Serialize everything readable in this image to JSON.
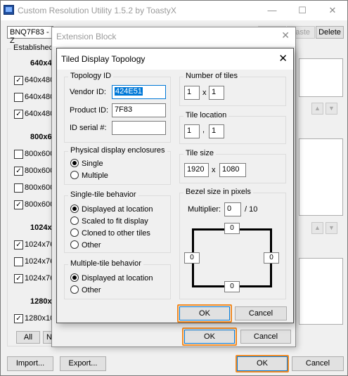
{
  "main": {
    "title": "Custom Resolution Utility 1.5.2 by ToastyX",
    "monitor": "BNQ7F83 - Z",
    "paste": "aste",
    "delete": "Delete",
    "established": "Established",
    "groups": [
      {
        "header": "640x48",
        "items": [
          {
            "label": "640x480",
            "checked": true
          },
          {
            "label": "640x480",
            "checked": false
          },
          {
            "label": "640x480",
            "checked": true
          }
        ]
      },
      {
        "header": "800x60",
        "items": [
          {
            "label": "800x600",
            "checked": false
          },
          {
            "label": "800x600",
            "checked": true
          },
          {
            "label": "800x600",
            "checked": false
          },
          {
            "label": "800x600",
            "checked": true
          }
        ]
      },
      {
        "header": "1024x7",
        "items": [
          {
            "label": "1024x76",
            "checked": true
          },
          {
            "label": "1024x76",
            "checked": false
          },
          {
            "label": "1024x76",
            "checked": true
          }
        ]
      },
      {
        "header": "1280x1",
        "items": [
          {
            "label": "1280x10",
            "checked": true
          }
        ]
      }
    ],
    "all": "All",
    "none": "N",
    "import": "Import...",
    "export": "Export...",
    "ok": "OK",
    "cancel": "Cancel",
    "check": "✓",
    "up": "▲",
    "down": "▼"
  },
  "ext": {
    "title": "Extension Block",
    "close": "✕",
    "ok": "OK",
    "cancel": "Cancel"
  },
  "tdt": {
    "title": "Tiled Display Topology",
    "close": "✕",
    "topology_id": "Topology ID",
    "vendor_label": "Vendor ID:",
    "vendor_value": "424E51",
    "product_label": "Product ID:",
    "product_value": "7F83",
    "serial_label": "ID serial #:",
    "serial_value": "",
    "enclosures_label": "Physical display enclosures",
    "enclosures": [
      {
        "label": "Single",
        "on": true
      },
      {
        "label": "Multiple",
        "on": false
      }
    ],
    "single_label": "Single-tile behavior",
    "single": [
      {
        "label": "Displayed at location",
        "on": true
      },
      {
        "label": "Scaled to fit display",
        "on": false
      },
      {
        "label": "Cloned to other tiles",
        "on": false
      },
      {
        "label": "Other",
        "on": false
      }
    ],
    "multi_label": "Multiple-tile behavior",
    "multi": [
      {
        "label": "Displayed at location",
        "on": true
      },
      {
        "label": "Other",
        "on": false
      }
    ],
    "num_tiles_label": "Number of tiles",
    "num_tiles": [
      "1",
      "1"
    ],
    "x_sep": "x",
    "tile_loc_label": "Tile location",
    "tile_loc": [
      "1",
      "1"
    ],
    "comma_sep": ",",
    "tile_size_label": "Tile size",
    "tile_size": [
      "1920",
      "1080"
    ],
    "bezel_label": "Bezel size in pixels",
    "multiplier_label": "Multiplier:",
    "multiplier": "0",
    "divisor": "/ 10",
    "bezel": {
      "top": "0",
      "left": "0",
      "right": "0",
      "bottom": "0"
    },
    "ok": "OK",
    "cancel": "Cancel"
  },
  "colors": {
    "highlight": "#f08a24",
    "selection": "#0078d7"
  }
}
